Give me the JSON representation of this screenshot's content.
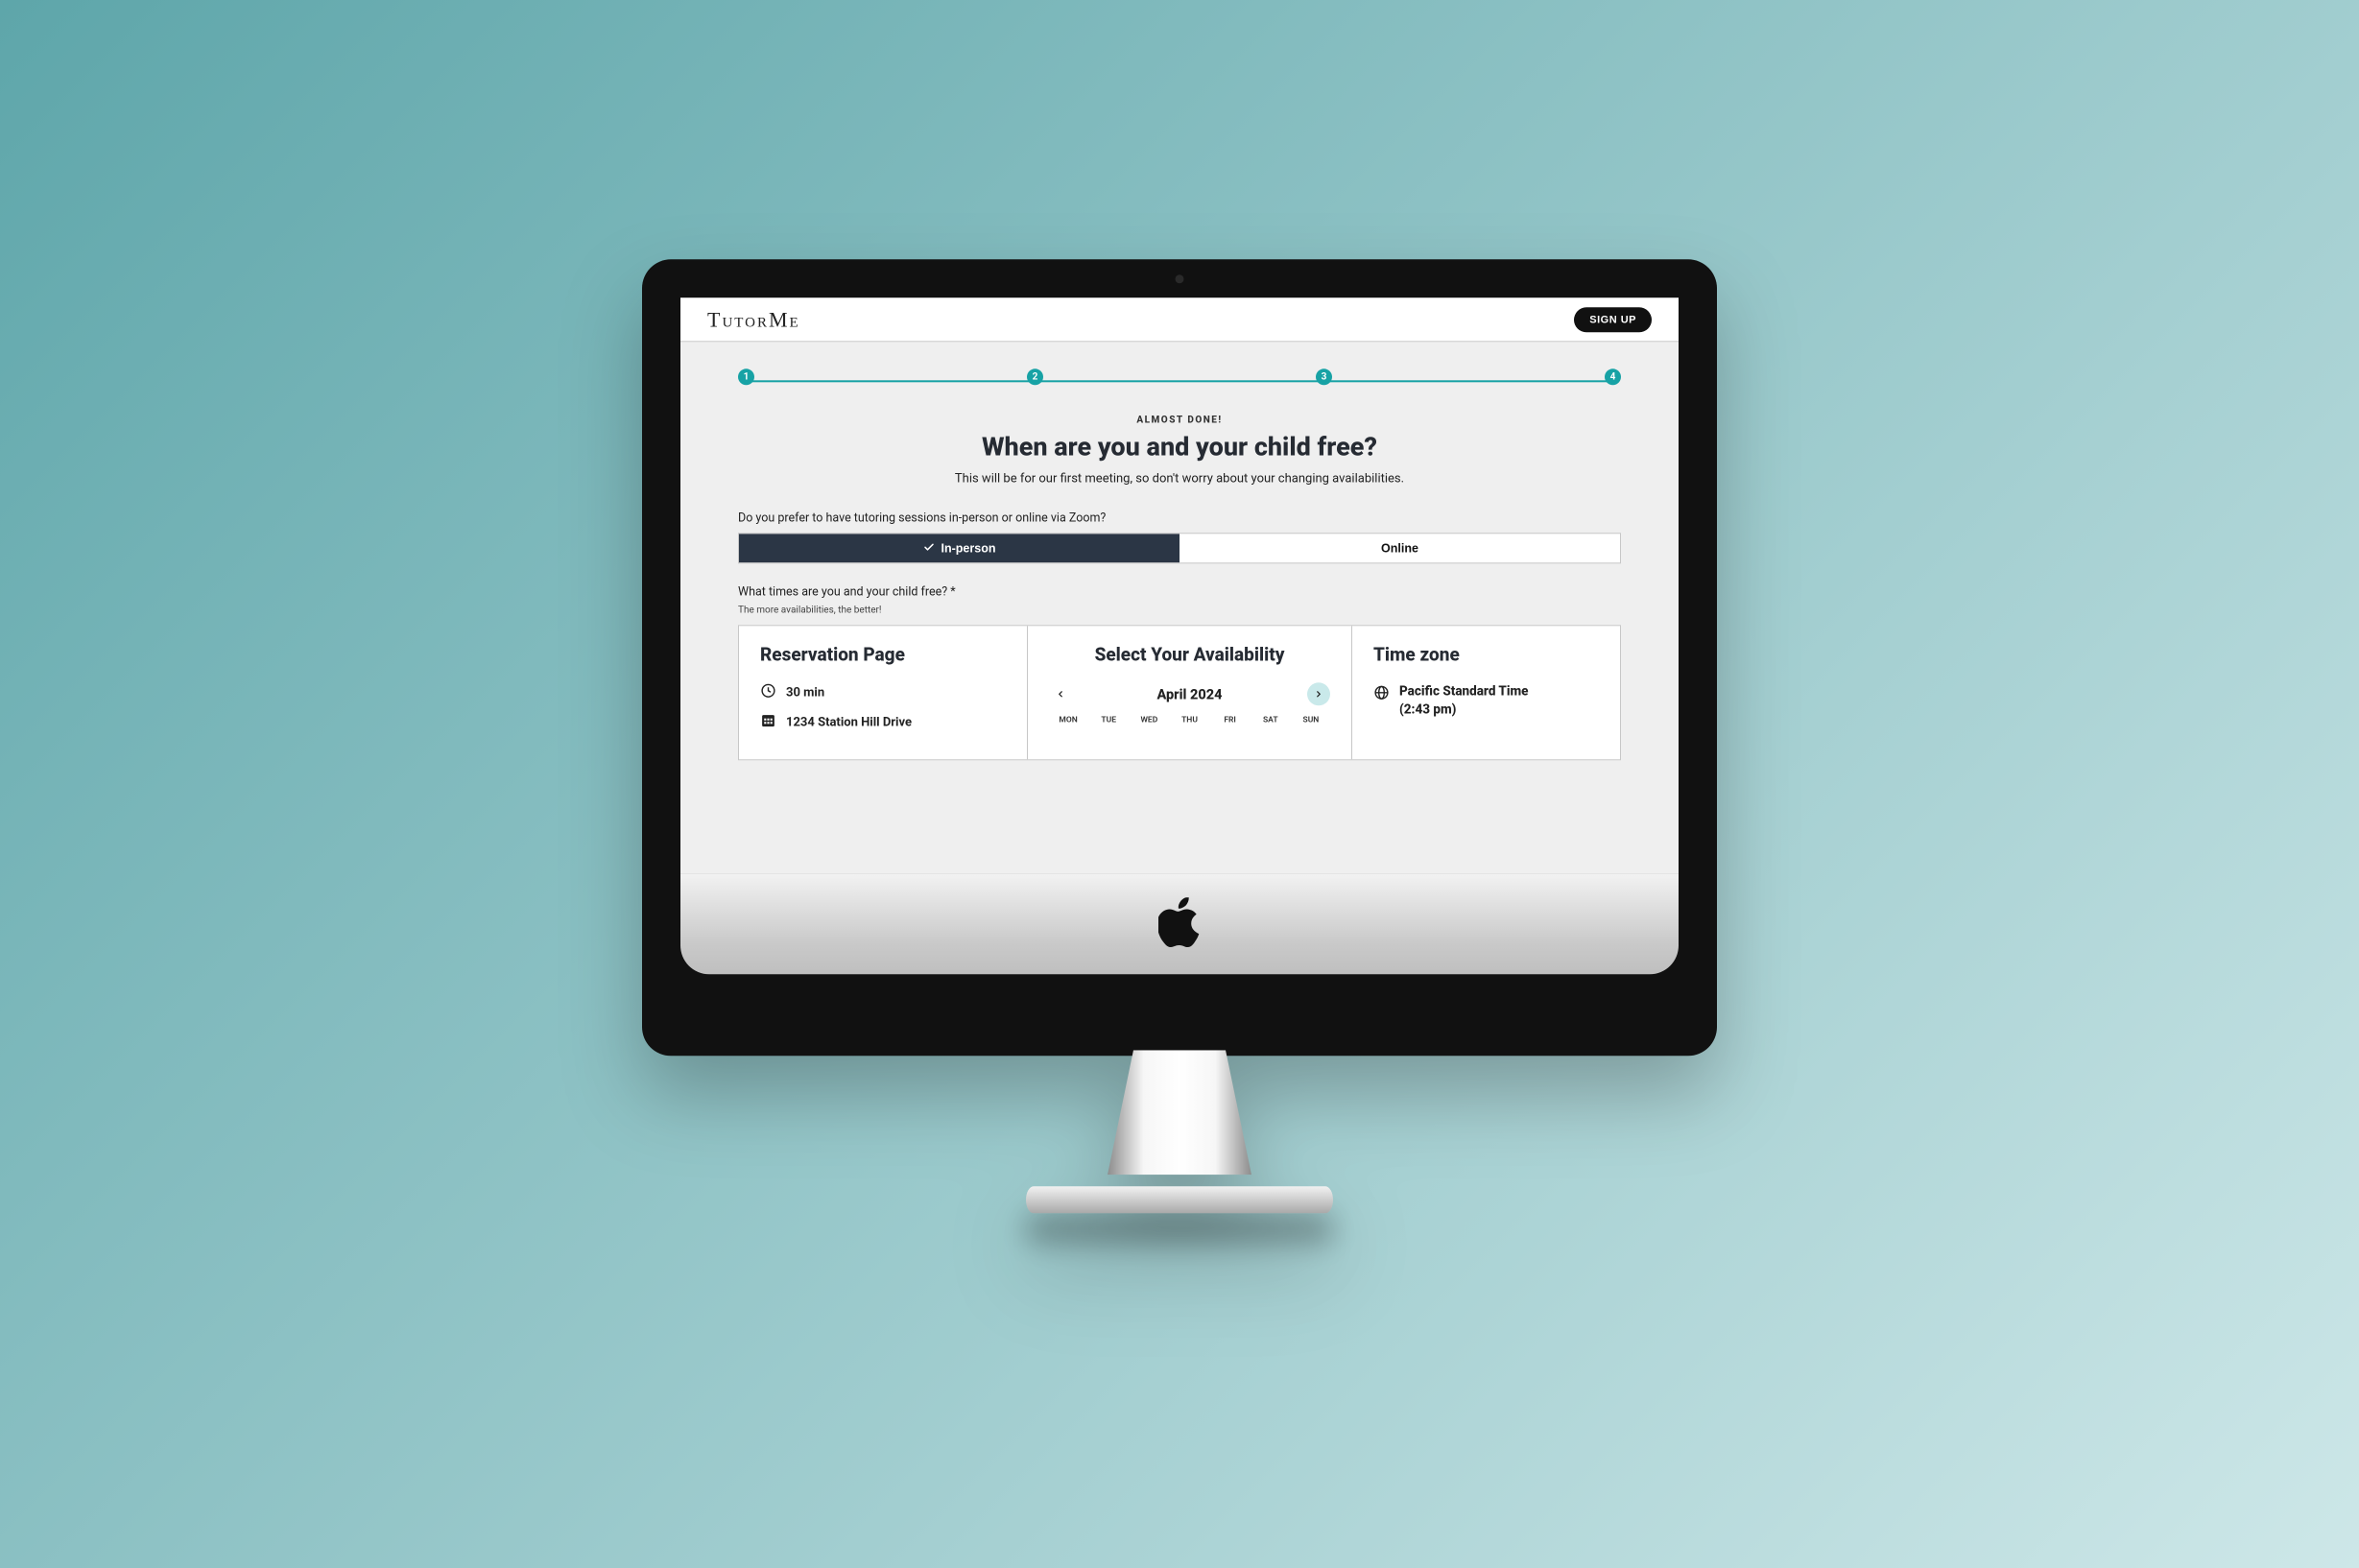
{
  "brand": "TutorMe",
  "header": {
    "signup_label": "SIGN UP"
  },
  "stepper": {
    "steps": [
      1,
      2,
      3,
      4
    ],
    "current": 4
  },
  "eyebrow": "ALMOST DONE!",
  "title": "When are you and your child free?",
  "subtitle": "This will be for our first meeting, so don't worry about your changing availabilities.",
  "mode_question": "Do you prefer to have tutoring sessions in-person or online via Zoom?",
  "mode": {
    "selected": "in_person",
    "in_person_label": "In-person",
    "online_label": "Online"
  },
  "avail_question": "What times are you and your child free? *",
  "avail_hint": "The more availabilities, the better!",
  "scheduler": {
    "reservation_heading": "Reservation Page",
    "duration_label": "30 min",
    "address_label": "1234 Station Hill Drive",
    "availability_heading": "Select Your Availability",
    "month_label": "April 2024",
    "days_of_week": [
      "MON",
      "TUE",
      "WED",
      "THU",
      "FRI",
      "SAT",
      "SUN"
    ],
    "timezone_heading": "Time zone",
    "timezone_line1": "Pacific Standard Time",
    "timezone_line2": "(2:43 pm)"
  }
}
